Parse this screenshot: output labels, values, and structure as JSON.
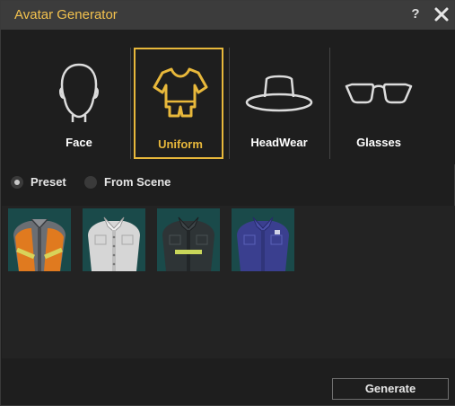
{
  "window": {
    "title": "Avatar Generator",
    "help_label": "?"
  },
  "categories": [
    {
      "label": "Face",
      "icon": "face-icon",
      "selected": false
    },
    {
      "label": "Uniform",
      "icon": "uniform-icon",
      "selected": true
    },
    {
      "label": "HeadWear",
      "icon": "hat-icon",
      "selected": false
    },
    {
      "label": "Glasses",
      "icon": "glasses-icon",
      "selected": false
    }
  ],
  "source": {
    "preset_label": "Preset",
    "from_scene_label": "From Scene",
    "selected": "Preset"
  },
  "thumbnails": [
    {
      "name": "orange-safety-vest-uniform"
    },
    {
      "name": "white-shirt-uniform"
    },
    {
      "name": "dark-reflective-jacket-uniform"
    },
    {
      "name": "blue-police-uniform"
    }
  ],
  "footer": {
    "generate_label": "Generate"
  },
  "colors": {
    "accent": "#e8b83b",
    "title": "#f2c14e",
    "thumb_bg": "#1a4a4a"
  }
}
